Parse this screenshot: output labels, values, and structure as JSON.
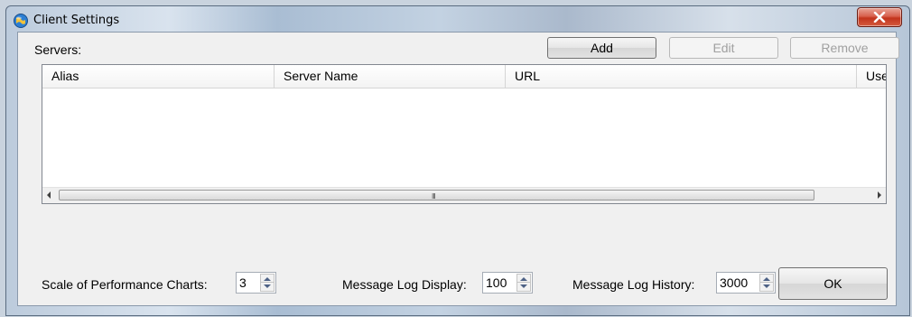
{
  "window": {
    "title": "Client Settings",
    "close_glyph": "X"
  },
  "servers": {
    "label": "Servers:",
    "add_label": "Add",
    "edit_label": "Edit",
    "remove_label": "Remove"
  },
  "table": {
    "columns": [
      "Alias",
      "Server Name",
      "URL",
      "Use S"
    ],
    "rows": [],
    "scroll_grip": "III"
  },
  "settings": {
    "scale_label": "Scale of Performance Charts:",
    "scale_value": "3",
    "log_display_label": "Message Log Display:",
    "log_display_value": "100",
    "log_history_label": "Message Log History:",
    "log_history_value": "3000"
  },
  "ok_label": "OK",
  "icons": {
    "app": "globe-icon",
    "close": "close-icon",
    "scroll_left": "arrow-left-icon",
    "scroll_right": "arrow-right-icon",
    "spinner": "spinner-arrows-icon"
  },
  "colors": {
    "close_button": "#c2341c",
    "title_gradient_light": "#d9e3ee",
    "title_gradient_dark": "#a9bdd3",
    "dialog_bg": "#f0f0f0",
    "disabled_text": "#a0a0a0"
  }
}
